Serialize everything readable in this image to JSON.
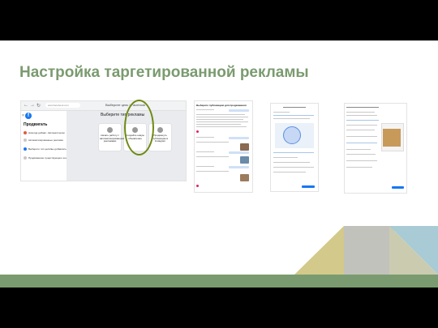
{
  "slide": {
    "title": "Настройка таргетированной рекламы"
  },
  "browser": {
    "url": "www.facebook.com",
    "tab_title": "Выберите цель | Facebook",
    "page_heading": "Выберите тип рекламы",
    "sidebar_heading": "Продвигать",
    "sidebar_items": [
      "Никогда добавл. Автоматически",
      "Автоматизированные реклама",
      "Выберите тип цели/вы добавлять",
      "Продвижение существующего контента"
    ],
    "cards": [
      "Начать работу с автоматизированными рекламами",
      "Создайте новую объявление",
      "Продвинуть публикацию в Instagram"
    ]
  },
  "shot2": {
    "heading": "Выберите публикацию для продвижения"
  },
  "shot3": {
    "heading": "Редактировать аудиторию"
  },
  "shot4": {
    "heading": "Бюджет и длительность"
  },
  "colors": {
    "accent_green": "#7a9b6f",
    "highlight_ellipse": "#6e8a12",
    "facebook_blue": "#1877f2"
  }
}
